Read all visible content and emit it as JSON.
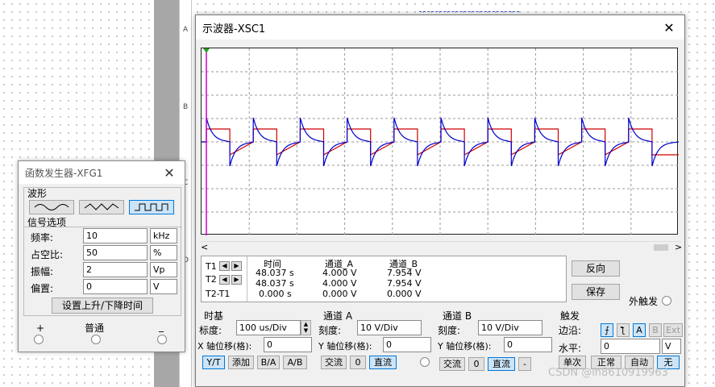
{
  "background": {
    "ruler_letters": [
      "A",
      "B",
      "C",
      "D"
    ]
  },
  "oscilloscope": {
    "title": "示波器-XSC1",
    "close_label": "✕",
    "screen": {
      "grid_cols": 10,
      "grid_rows": 8,
      "square_color": "#cc0000",
      "pulse_color": "#0000cc",
      "cursor1_color": "#cc00cc",
      "periods": 10
    },
    "readout": {
      "t1_label": "T1",
      "t2_label": "T2",
      "t2t1_label": "T2-T1",
      "headers": [
        "时间",
        "通道_A",
        "通道_B"
      ],
      "rows": [
        [
          "48.037 s",
          "4.000 V",
          "7.954 V"
        ],
        [
          "48.037 s",
          "4.000 V",
          "7.954 V"
        ],
        [
          "0.000 s",
          "0.000 V",
          "0.000 V"
        ]
      ]
    },
    "reverse_label": "反向",
    "save_label": "保存",
    "ext_trigger_label": "外触发",
    "timebase": {
      "title": "时基",
      "scale_label": "标度:",
      "scale_value": "100 us/Div",
      "xpos_label": "X 轴位移(格):",
      "xpos_value": "0",
      "modes": [
        "Y/T",
        "添加",
        "B/A",
        "A/B"
      ]
    },
    "channel_a": {
      "title": "通道 A",
      "scale_label": "刻度:",
      "scale_value": "10  V/Div",
      "ypos_label": "Y 轴位移(格):",
      "ypos_value": "0",
      "coupling": [
        "交流",
        "0",
        "直流"
      ]
    },
    "channel_b": {
      "title": "通道 B",
      "scale_label": "刻度:",
      "scale_value": "10  V/Div",
      "ypos_label": "Y 轴位移(格):",
      "ypos_value": "0",
      "coupling": [
        "交流",
        "0",
        "直流",
        "-"
      ]
    },
    "trigger": {
      "title": "触发",
      "edge_label": "边沿:",
      "edge_buttons": [
        "A",
        "B",
        "Ext"
      ],
      "level_label": "水平:",
      "level_value": "0",
      "level_unit": "V",
      "modes": [
        "单次",
        "正常",
        "自动",
        "无"
      ]
    }
  },
  "function_generator": {
    "title": "函数发生器-XFG1",
    "close_label": "✕",
    "waveform_label": "波形",
    "signal_options_label": "信号选项",
    "params": [
      {
        "label": "频率:",
        "value": "10",
        "unit": "kHz"
      },
      {
        "label": "占空比:",
        "value": "50",
        "unit": "%"
      },
      {
        "label": "振幅:",
        "value": "2",
        "unit": "Vp"
      },
      {
        "label": "偏置:",
        "value": "0",
        "unit": "V"
      }
    ],
    "rise_fall_label": "设置上升/下降时间",
    "terminals": [
      "+",
      "普通",
      "_"
    ]
  },
  "watermark": "CSDN @lh8610919963"
}
